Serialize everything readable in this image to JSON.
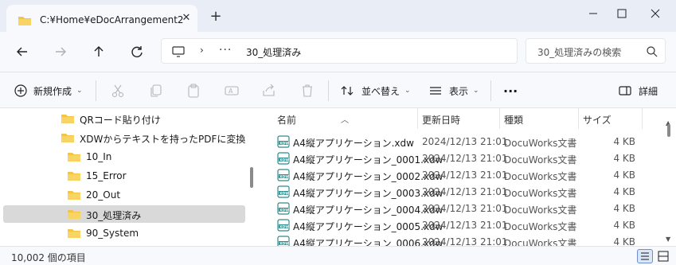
{
  "window": {
    "tab_title": "C:¥Home¥eDocArrangement2",
    "close_tab_glyph": "✕",
    "new_tab_glyph": "+"
  },
  "address": {
    "chevron": "›",
    "overflow": "···",
    "crumb": "30_処理済み",
    "search_placeholder": "30_処理済みの検索"
  },
  "toolbar": {
    "new_label": "新規作成",
    "sort_label": "並べ替え",
    "view_label": "表示",
    "more_label": "···",
    "details_label": "詳細",
    "dropdown_glyph": "⌄"
  },
  "tree": [
    {
      "label": "QRコード貼り付け",
      "level": 1,
      "selected": false
    },
    {
      "label": "XDWからテキストを持ったPDFに変換",
      "level": 1,
      "selected": false
    },
    {
      "label": "10_In",
      "level": 2,
      "selected": false
    },
    {
      "label": "15_Error",
      "level": 2,
      "selected": false
    },
    {
      "label": "20_Out",
      "level": 2,
      "selected": false
    },
    {
      "label": "30_処理済み",
      "level": 2,
      "selected": true
    },
    {
      "label": "90_System",
      "level": 2,
      "selected": false
    }
  ],
  "columns": {
    "name": "名前",
    "date": "更新日時",
    "type": "種類",
    "size": "サイズ",
    "sort_glyph": "︿"
  },
  "files": [
    {
      "name": "A4縦アプリケーション.xdw",
      "date": "2024/12/13 21:01",
      "type": "DocuWorks文書",
      "size": "4 KB"
    },
    {
      "name": "A4縦アプリケーション_0001.xdw",
      "date": "2024/12/13 21:01",
      "type": "DocuWorks文書",
      "size": "4 KB"
    },
    {
      "name": "A4縦アプリケーション_0002.xdw",
      "date": "2024/12/13 21:01",
      "type": "DocuWorks文書",
      "size": "4 KB"
    },
    {
      "name": "A4縦アプリケーション_0003.xdw",
      "date": "2024/12/13 21:01",
      "type": "DocuWorks文書",
      "size": "4 KB"
    },
    {
      "name": "A4縦アプリケーション_0004.xdw",
      "date": "2024/12/13 21:01",
      "type": "DocuWorks文書",
      "size": "4 KB"
    },
    {
      "name": "A4縦アプリケーション_0005.xdw",
      "date": "2024/12/13 21:01",
      "type": "DocuWorks文書",
      "size": "4 KB"
    },
    {
      "name": "A4縦アプリケーション_0006.xdw",
      "date": "2024/12/13 21:01",
      "type": "DocuWorks文書",
      "size": "4 KB"
    }
  ],
  "status": {
    "item_count": "10,002 個の項目"
  },
  "colors": {
    "folder": "#f4c542",
    "accent": "#005fb8",
    "xdw_icon": "#2e8b8b"
  }
}
